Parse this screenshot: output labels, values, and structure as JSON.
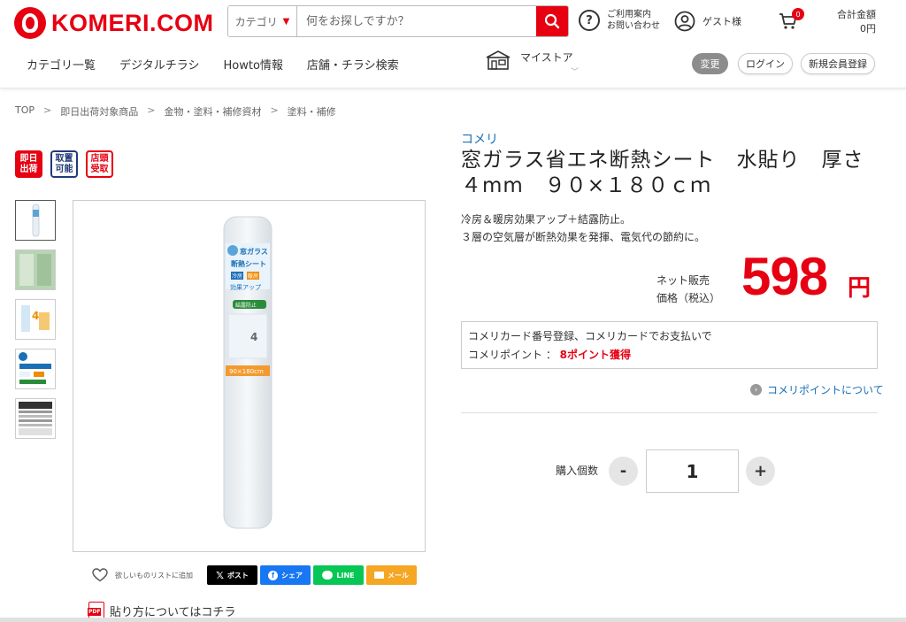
{
  "header": {
    "logo_text": "KOMERI.COM",
    "search": {
      "category_label": "カテゴリ",
      "placeholder": "何をお探しですか？"
    },
    "help_line1": "ご利用案内",
    "help_line2": "お問い合わせ",
    "guest_label": "ゲスト様",
    "cart_count": "0",
    "total_label": "合計金額",
    "total_value": "0円"
  },
  "nav": {
    "items": [
      "カテゴリ一覧",
      "デジタルチラシ",
      "Howto情報",
      "店舗・チラシ検索"
    ],
    "mystore_label": "マイストア",
    "change_label": "変更",
    "login_label": "ログイン",
    "register_label": "新規会員登録"
  },
  "breadcrumb": [
    "TOP",
    "即日出荷対象商品",
    "金物・塗料・補修資材",
    "塗料・補修"
  ],
  "badges": [
    {
      "line1": "即日",
      "line2": "出荷"
    },
    {
      "line1": "取置",
      "line2": "可能"
    },
    {
      "line1": "店頭",
      "line2": "受取"
    }
  ],
  "product": {
    "brand": "コメリ",
    "title": "窓ガラス省エネ断熱シート　水貼り　厚さ４mm　９０×１８０ｃｍ",
    "desc_line1": "冷房＆暖房効果アップ＋結露防止。",
    "desc_line2": "３層の空気層が断熱効果を発揮、電気代の節約に。",
    "package_text": [
      "窓ガラス",
      "断熱シート",
      "冷房",
      "暖房",
      "効果アップ",
      "結露防止",
      "90×180cm"
    ],
    "price_label_line1": "ネット販売",
    "price_label_line2": "価格（税込）",
    "price": "598",
    "currency": "円"
  },
  "points": {
    "line1": "コメリカード番号登録、コメリカードでお支払いで",
    "line2_prefix": "コメリポイント ：",
    "line2_value": "8ポイント獲得",
    "link_label": "コメリポイントについて"
  },
  "quantity": {
    "label": "購入個数",
    "value": "1",
    "minus": "-",
    "plus": "+"
  },
  "share": {
    "wishlist_label": "欲しいものリストに追加",
    "x_label": "ポスト",
    "facebook_label": "シェア",
    "line_label": "LINE",
    "mail_label": "メール"
  },
  "pdf": {
    "icon_text": "PDF",
    "label": "貼り方についてはコチラ"
  },
  "colors": {
    "brand_red": "#e60012",
    "link_blue": "#1a6fb5"
  }
}
